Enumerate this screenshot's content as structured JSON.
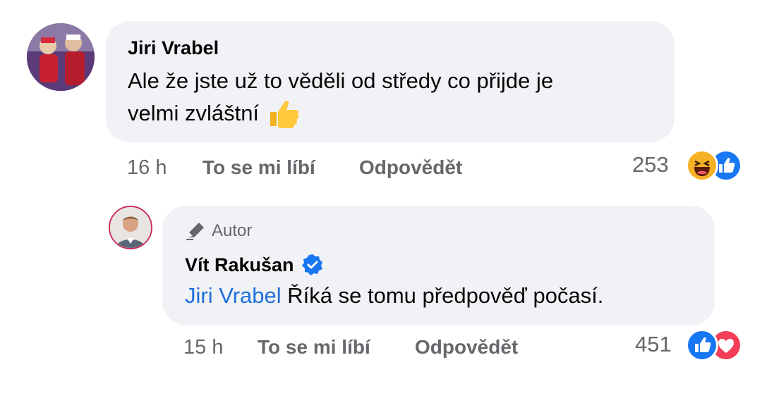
{
  "comment1": {
    "author": "Jiri Vrabel",
    "text_line1": "Ale že jste už to věděli od středy co přijde je",
    "text_line2": "velmi zvláštní",
    "emoji_icon": "thumbs-up-emoji",
    "time": "16 h",
    "like_label": "To se mi líbí",
    "reply_label": "Odpovědět",
    "reaction_count": "253",
    "reactions": [
      "haha-reaction",
      "like-reaction"
    ]
  },
  "comment2": {
    "badge": "Autor",
    "author": "Vít Rakušan",
    "verified_icon": "verified-badge-icon",
    "mention": "Jiri Vrabel",
    "text": "Říká se tomu předpověď počasí.",
    "time": "15 h",
    "like_label": "To se mi líbí",
    "reply_label": "Odpovědět",
    "reaction_count": "451",
    "reactions": [
      "like-reaction",
      "love-reaction"
    ]
  },
  "colors": {
    "bubble": "#f0f2f5",
    "mention": "#216fdb",
    "meta": "#65676b",
    "like_blue": "#1877f2",
    "love_red": "#f33e58",
    "haha_yellow": "#f7b125"
  }
}
